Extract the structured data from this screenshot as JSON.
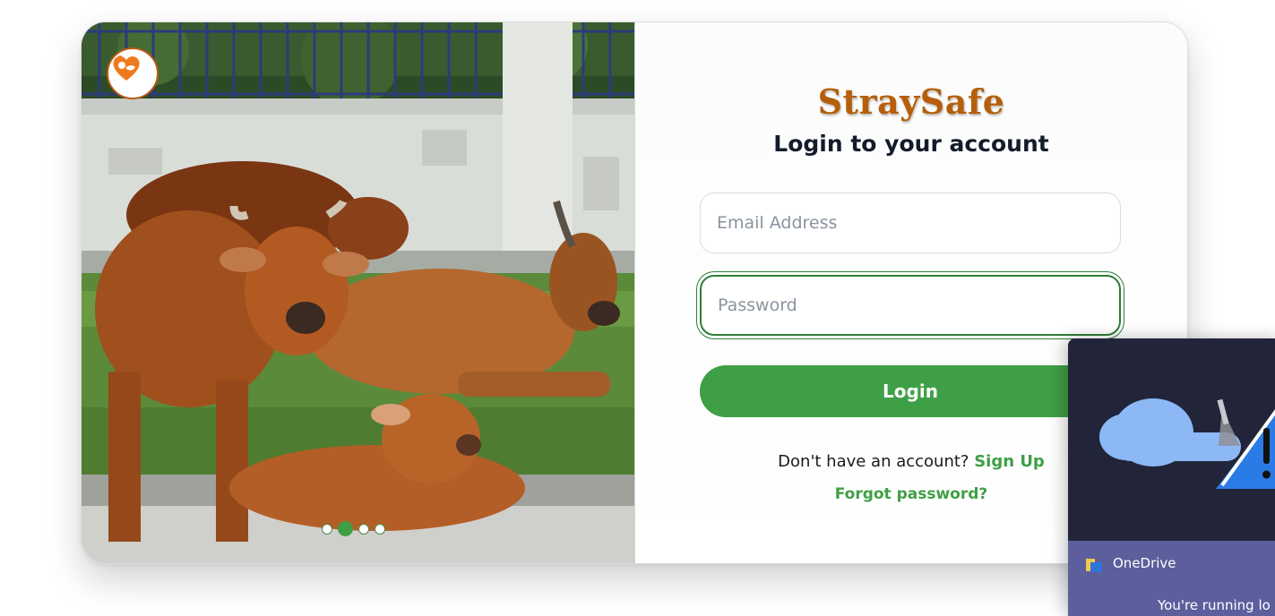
{
  "brand": {
    "name": "StraySafe",
    "logo_icon": "pet-heart-icon"
  },
  "login": {
    "title": "Login to your account",
    "email_placeholder": "Email Address",
    "password_placeholder": "Password",
    "login_label": "Login",
    "signup_prompt": "Don't have an account?",
    "signup_link": "Sign Up",
    "forgot_link": "Forgot password?"
  },
  "carousel": {
    "slide_count": 4,
    "active_index": 1
  },
  "notification": {
    "app_name": "OneDrive",
    "message": "You're running lo",
    "icons": [
      "cloud-icon",
      "warning-icon"
    ]
  },
  "colors": {
    "brand": "#b55e0b",
    "primary": "#3f9f46",
    "toast_bg": "#22253a",
    "toast_footer": "#5c5f9c"
  }
}
